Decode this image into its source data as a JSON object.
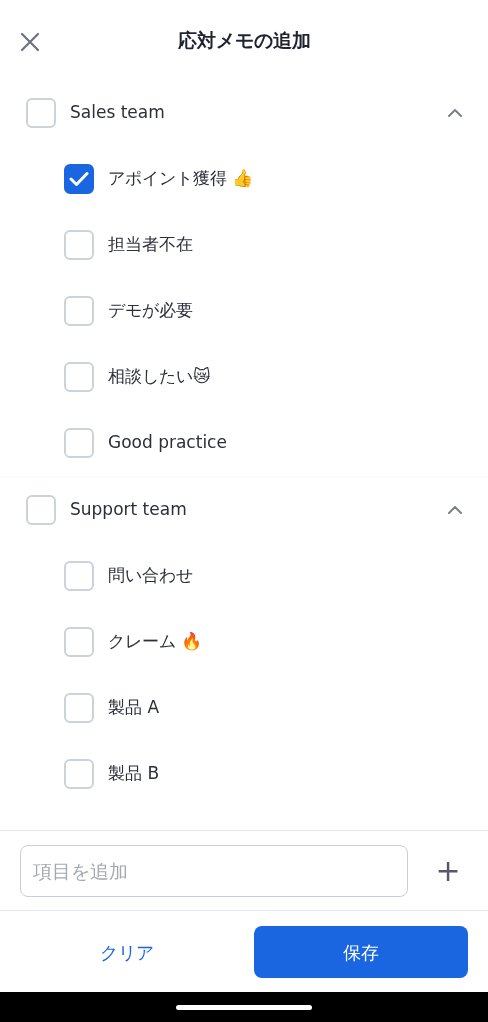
{
  "header": {
    "title": "応対メモの追加"
  },
  "groups": [
    {
      "label": "Sales team",
      "checked": false,
      "expanded": true,
      "items": [
        {
          "label": "アポイント獲得 👍",
          "checked": true
        },
        {
          "label": "担当者不在",
          "checked": false
        },
        {
          "label": "デモが必要",
          "checked": false
        },
        {
          "label": "相談したい😿",
          "checked": false
        },
        {
          "label": "Good practice",
          "checked": false
        }
      ]
    },
    {
      "label": "Support team",
      "checked": false,
      "expanded": true,
      "items": [
        {
          "label": "問い合わせ",
          "checked": false
        },
        {
          "label": "クレーム 🔥",
          "checked": false
        },
        {
          "label": "製品 A",
          "checked": false
        },
        {
          "label": "製品 B",
          "checked": false
        }
      ]
    }
  ],
  "add_field": {
    "placeholder": "項目を追加",
    "button": "+"
  },
  "footer": {
    "clear": "クリア",
    "save": "保存"
  }
}
